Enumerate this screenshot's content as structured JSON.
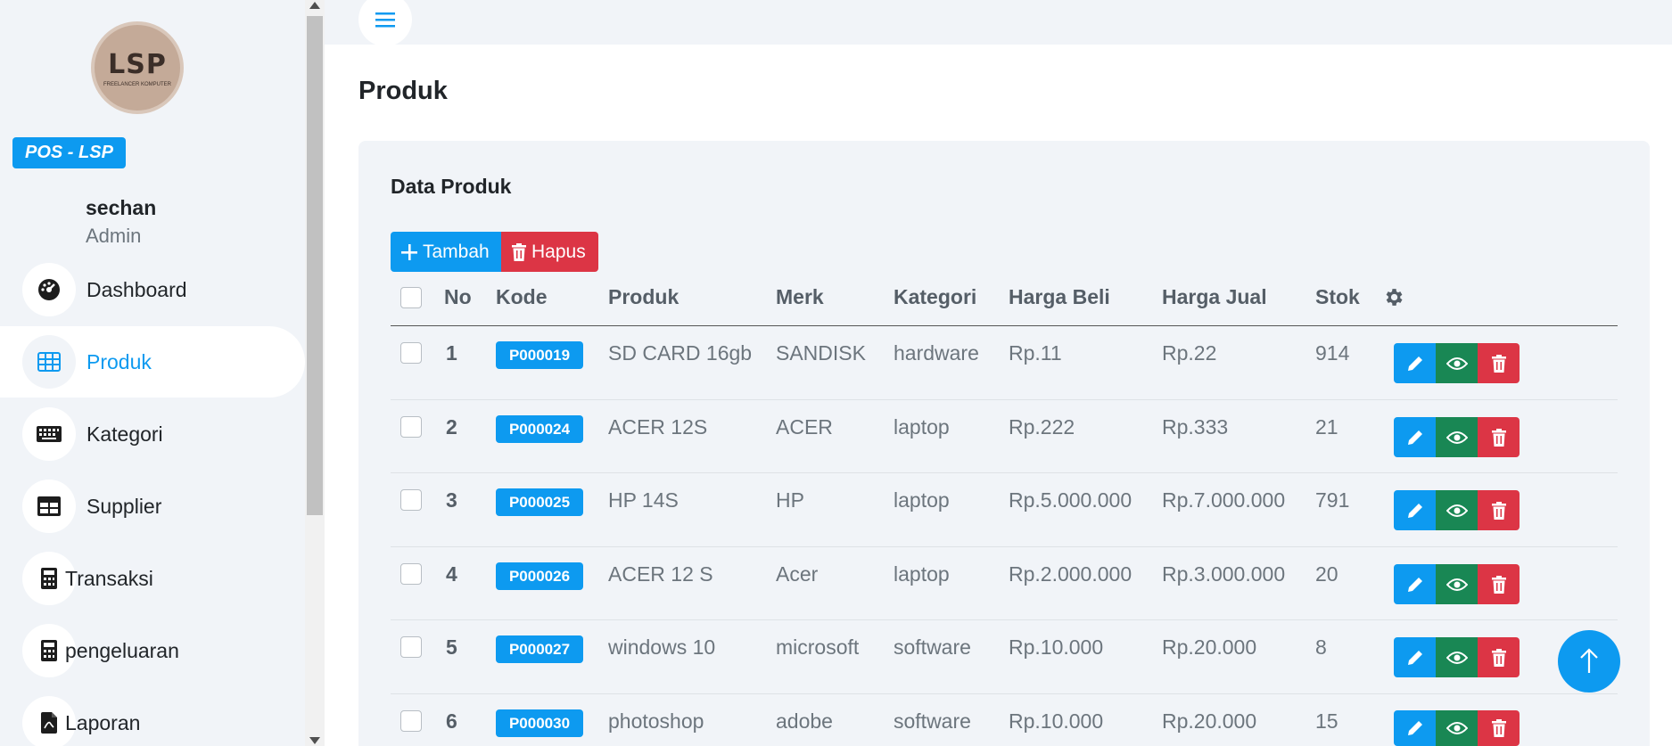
{
  "sidebar": {
    "logo": {
      "text": "LSP",
      "sub": "FREELANCER KOMPUTER"
    },
    "brand": "POS - LSP",
    "user": {
      "name": "sechan",
      "role": "Admin"
    },
    "items": [
      {
        "label": "Dashboard",
        "icon": "gauge-icon",
        "active": false
      },
      {
        "label": "Produk",
        "icon": "grid-icon",
        "active": true
      },
      {
        "label": "Kategori",
        "icon": "keyboard-icon",
        "active": false
      },
      {
        "label": "Supplier",
        "icon": "table-icon",
        "active": false
      },
      {
        "label": "Transaksi",
        "icon": "calculator-icon",
        "active": false
      },
      {
        "label": "pengeluaran",
        "icon": "calculator-icon",
        "active": false
      },
      {
        "label": "Laporan",
        "icon": "file-pdf-icon",
        "active": false
      }
    ]
  },
  "header": {
    "menu_icon": "hamburger-icon"
  },
  "page": {
    "title": "Produk"
  },
  "card": {
    "title": "Data Produk",
    "add_label": "Tambah",
    "delete_label": "Hapus"
  },
  "table": {
    "columns": [
      "No",
      "Kode",
      "Produk",
      "Merk",
      "Kategori",
      "Harga Beli",
      "Harga Jual",
      "Stok"
    ],
    "settings_icon": "gear-icon",
    "rows": [
      {
        "no": "1",
        "kode": "P000019",
        "produk": "SD CARD 16gb",
        "merk": "SANDISK",
        "kategori": "hardware",
        "harga_beli": "Rp.11",
        "harga_jual": "Rp.22",
        "stok": "914"
      },
      {
        "no": "2",
        "kode": "P000024",
        "produk": "ACER 12S",
        "merk": "ACER",
        "kategori": "laptop",
        "harga_beli": "Rp.222",
        "harga_jual": "Rp.333",
        "stok": "21"
      },
      {
        "no": "3",
        "kode": "P000025",
        "produk": "HP 14S",
        "merk": "HP",
        "kategori": "laptop",
        "harga_beli": "Rp.5.000.000",
        "harga_jual": "Rp.7.000.000",
        "stok": "791"
      },
      {
        "no": "4",
        "kode": "P000026",
        "produk": "ACER 12 S",
        "merk": "Acer",
        "kategori": "laptop",
        "harga_beli": "Rp.2.000.000",
        "harga_jual": "Rp.3.000.000",
        "stok": "20"
      },
      {
        "no": "5",
        "kode": "P000027",
        "produk": "windows 10",
        "merk": "microsoft",
        "kategori": "software",
        "harga_beli": "Rp.10.000",
        "harga_jual": "Rp.20.000",
        "stok": "8"
      },
      {
        "no": "6",
        "kode": "P000030",
        "produk": "photoshop",
        "merk": "adobe",
        "kategori": "software",
        "harga_beli": "Rp.10.000",
        "harga_jual": "Rp.20.000",
        "stok": "15"
      }
    ]
  },
  "colors": {
    "primary": "#0d9af0",
    "danger": "#dc3545",
    "success": "#198754",
    "sidebar_bg": "#f1f4f8"
  }
}
